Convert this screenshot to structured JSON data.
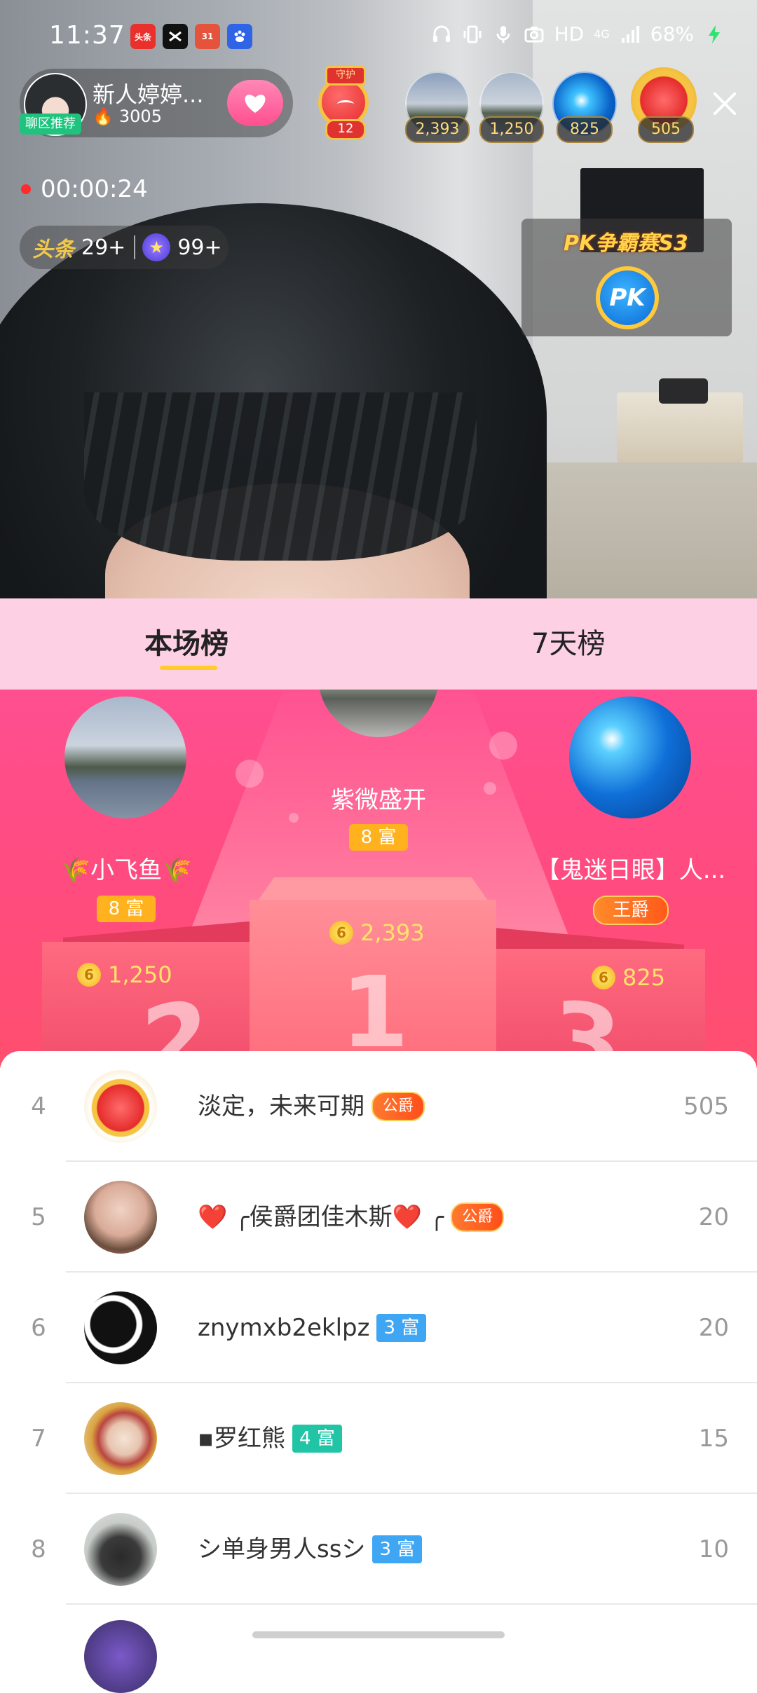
{
  "status_bar": {
    "time": "11:37",
    "apps": [
      "头条",
      "",
      "31",
      ""
    ],
    "network": "HD",
    "signal": "4G",
    "battery": "68%"
  },
  "host": {
    "tag": "聊区推荐",
    "name": "新人婷婷...",
    "heat": "3005"
  },
  "guard": {
    "title": "守护",
    "count": "12"
  },
  "audience": [
    {
      "count": "2,393"
    },
    {
      "count": "1,250"
    },
    {
      "count": "825"
    },
    {
      "count": "505"
    }
  ],
  "timer": "00:00:24",
  "ranks": {
    "headline": "头条",
    "headline_count": "29+",
    "star_count": "99+"
  },
  "pk": {
    "title": "PK争霸赛S3",
    "button": "PK"
  },
  "tabs": {
    "current": "本场榜",
    "week": "7天榜"
  },
  "podium": {
    "first": {
      "name": "紫微盛开",
      "level": "8 富",
      "score": "2,393",
      "place": "1"
    },
    "second": {
      "name": "🌾小飞鱼🌾",
      "level": "8 富",
      "score": "1,250",
      "place": "2"
    },
    "third": {
      "name": "【鬼迷日眼】人...",
      "level": "王爵",
      "score": "825",
      "place": "3"
    }
  },
  "list": [
    {
      "rank": "4",
      "name": "淡定，未来可期",
      "badge": "公爵",
      "badge_type": "noble",
      "score": "505"
    },
    {
      "rank": "5",
      "name": "❤️ ╭侯爵团佳木斯❤️ ╭",
      "badge": "公爵",
      "badge_type": "noble",
      "score": "20"
    },
    {
      "rank": "6",
      "name": "znymxb2eklpz",
      "badge": "3 富",
      "badge_type": "blue",
      "score": "20"
    },
    {
      "rank": "7",
      "name": "▪罗红熊",
      "badge": "4 富",
      "badge_type": "teal",
      "score": "15"
    },
    {
      "rank": "8",
      "name": "シ单身男人ssシ",
      "badge": "3 富",
      "badge_type": "blue",
      "score": "10"
    }
  ],
  "colors": {
    "podium_pink": "#ff4f90",
    "tab_bg": "#fdd0e4",
    "tab_underline": "#ffcc2a",
    "score_gold": "#ffe36a",
    "badge_blue": "#3fa6f4",
    "badge_teal": "#21c5a6"
  }
}
